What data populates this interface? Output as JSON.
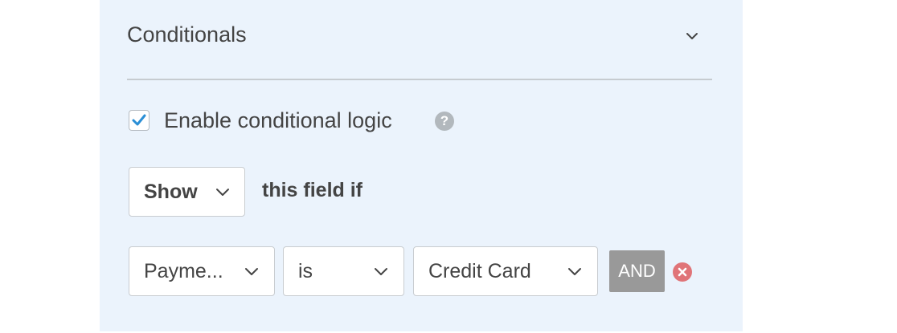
{
  "panel": {
    "title": "Conditionals",
    "collapse_icon": "chevron-down-icon"
  },
  "conditional_logic": {
    "enable_label": "Enable conditional logic",
    "enabled": true,
    "help_icon": "question-circle-icon",
    "help_glyph": "?"
  },
  "action": {
    "selected": "Show",
    "suffix_text": "this field if"
  },
  "rule": {
    "field": "Payme...",
    "operator": "is",
    "value": "Credit Card",
    "and_label": "AND",
    "remove_icon": "remove-circle-icon"
  },
  "colors": {
    "panel_background": "#ebf3fc",
    "checkmark": "#2b8fd6",
    "and_button": "#999999",
    "remove_icon": "#e07478",
    "text": "#444444"
  }
}
